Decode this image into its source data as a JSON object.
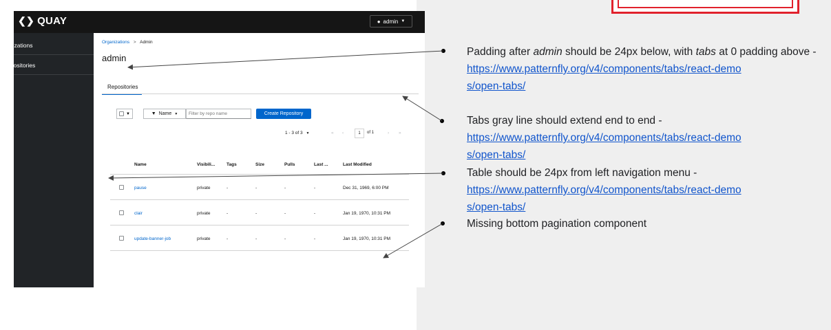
{
  "masthead": {
    "logo_text": "QUAY",
    "user_label": "admin"
  },
  "sidebar": {
    "items": [
      {
        "label": "Organizations"
      },
      {
        "label": "Repositories"
      }
    ]
  },
  "breadcrumb": {
    "parent": "Organizations",
    "separator": ">",
    "current": "Admin"
  },
  "page_title": "admin",
  "tabs": [
    {
      "label": "Repositories"
    }
  ],
  "toolbar": {
    "filter_attribute": "Name",
    "search_placeholder": "Filter by repo name",
    "create_button": "Create Repository",
    "pagination_range": "1 - 3 of 3",
    "page_number": "1",
    "page_total": "of 1"
  },
  "table": {
    "columns": [
      "Name",
      "Visibili...",
      "Tags",
      "Size",
      "Pulls",
      "Last ...",
      "Last Modified"
    ],
    "rows": [
      {
        "name": "pause",
        "visibility": "private",
        "tags": "-",
        "size": "-",
        "pulls": "-",
        "last": "-",
        "modified": "Dec 31, 1969, 6:00 PM"
      },
      {
        "name": "clair",
        "visibility": "private",
        "tags": "-",
        "size": "-",
        "pulls": "-",
        "last": "-",
        "modified": "Jan 19, 1970, 10:31 PM"
      },
      {
        "name": "update-banner-job",
        "visibility": "private",
        "tags": "-",
        "size": "-",
        "pulls": "-",
        "last": "-",
        "modified": "Jan 19, 1970, 10:31 PM"
      }
    ]
  },
  "notes": [
    {
      "parts": [
        "Padding after ",
        "admin",
        " should be 24px below, with ",
        "tabs",
        " at 0 padding above -"
      ],
      "link": "https://www.patternfly.org/v4/components/tabs/react-demos/open-tabs/",
      "link_line1": "https://www.patternfly.org/v4/components/tabs/react-demo",
      "link_line2": "s/open-tabs/"
    },
    {
      "text": "Tabs gray line should extend end to end -",
      "link": "https://www.patternfly.org/v4/components/tabs/react-demos/open-tabs/",
      "link_line1": "https://www.patternfly.org/v4/components/tabs/react-demo",
      "link_line2": "s/open-tabs/"
    },
    {
      "text": "Table should be 24px from left navigation menu -",
      "link": "https://www.patternfly.org/v4/components/tabs/react-demos/open-tabs/",
      "link_line1": "https://www.patternfly.org/v4/components/tabs/react-demo",
      "link_line2": "s/open-tabs/"
    },
    {
      "text": "Missing bottom pagination component"
    }
  ],
  "colors": {
    "accent": "#0066cc",
    "masthead": "#151515",
    "sidebar": "#212427",
    "stamp": "#e1212c",
    "panel": "#efefef"
  },
  "icons": [
    "quay-logo-icon",
    "user-icon",
    "caret-down-icon",
    "filter-icon",
    "first-page-icon",
    "prev-page-icon",
    "next-page-icon",
    "last-page-icon",
    "checkbox-icon"
  ]
}
